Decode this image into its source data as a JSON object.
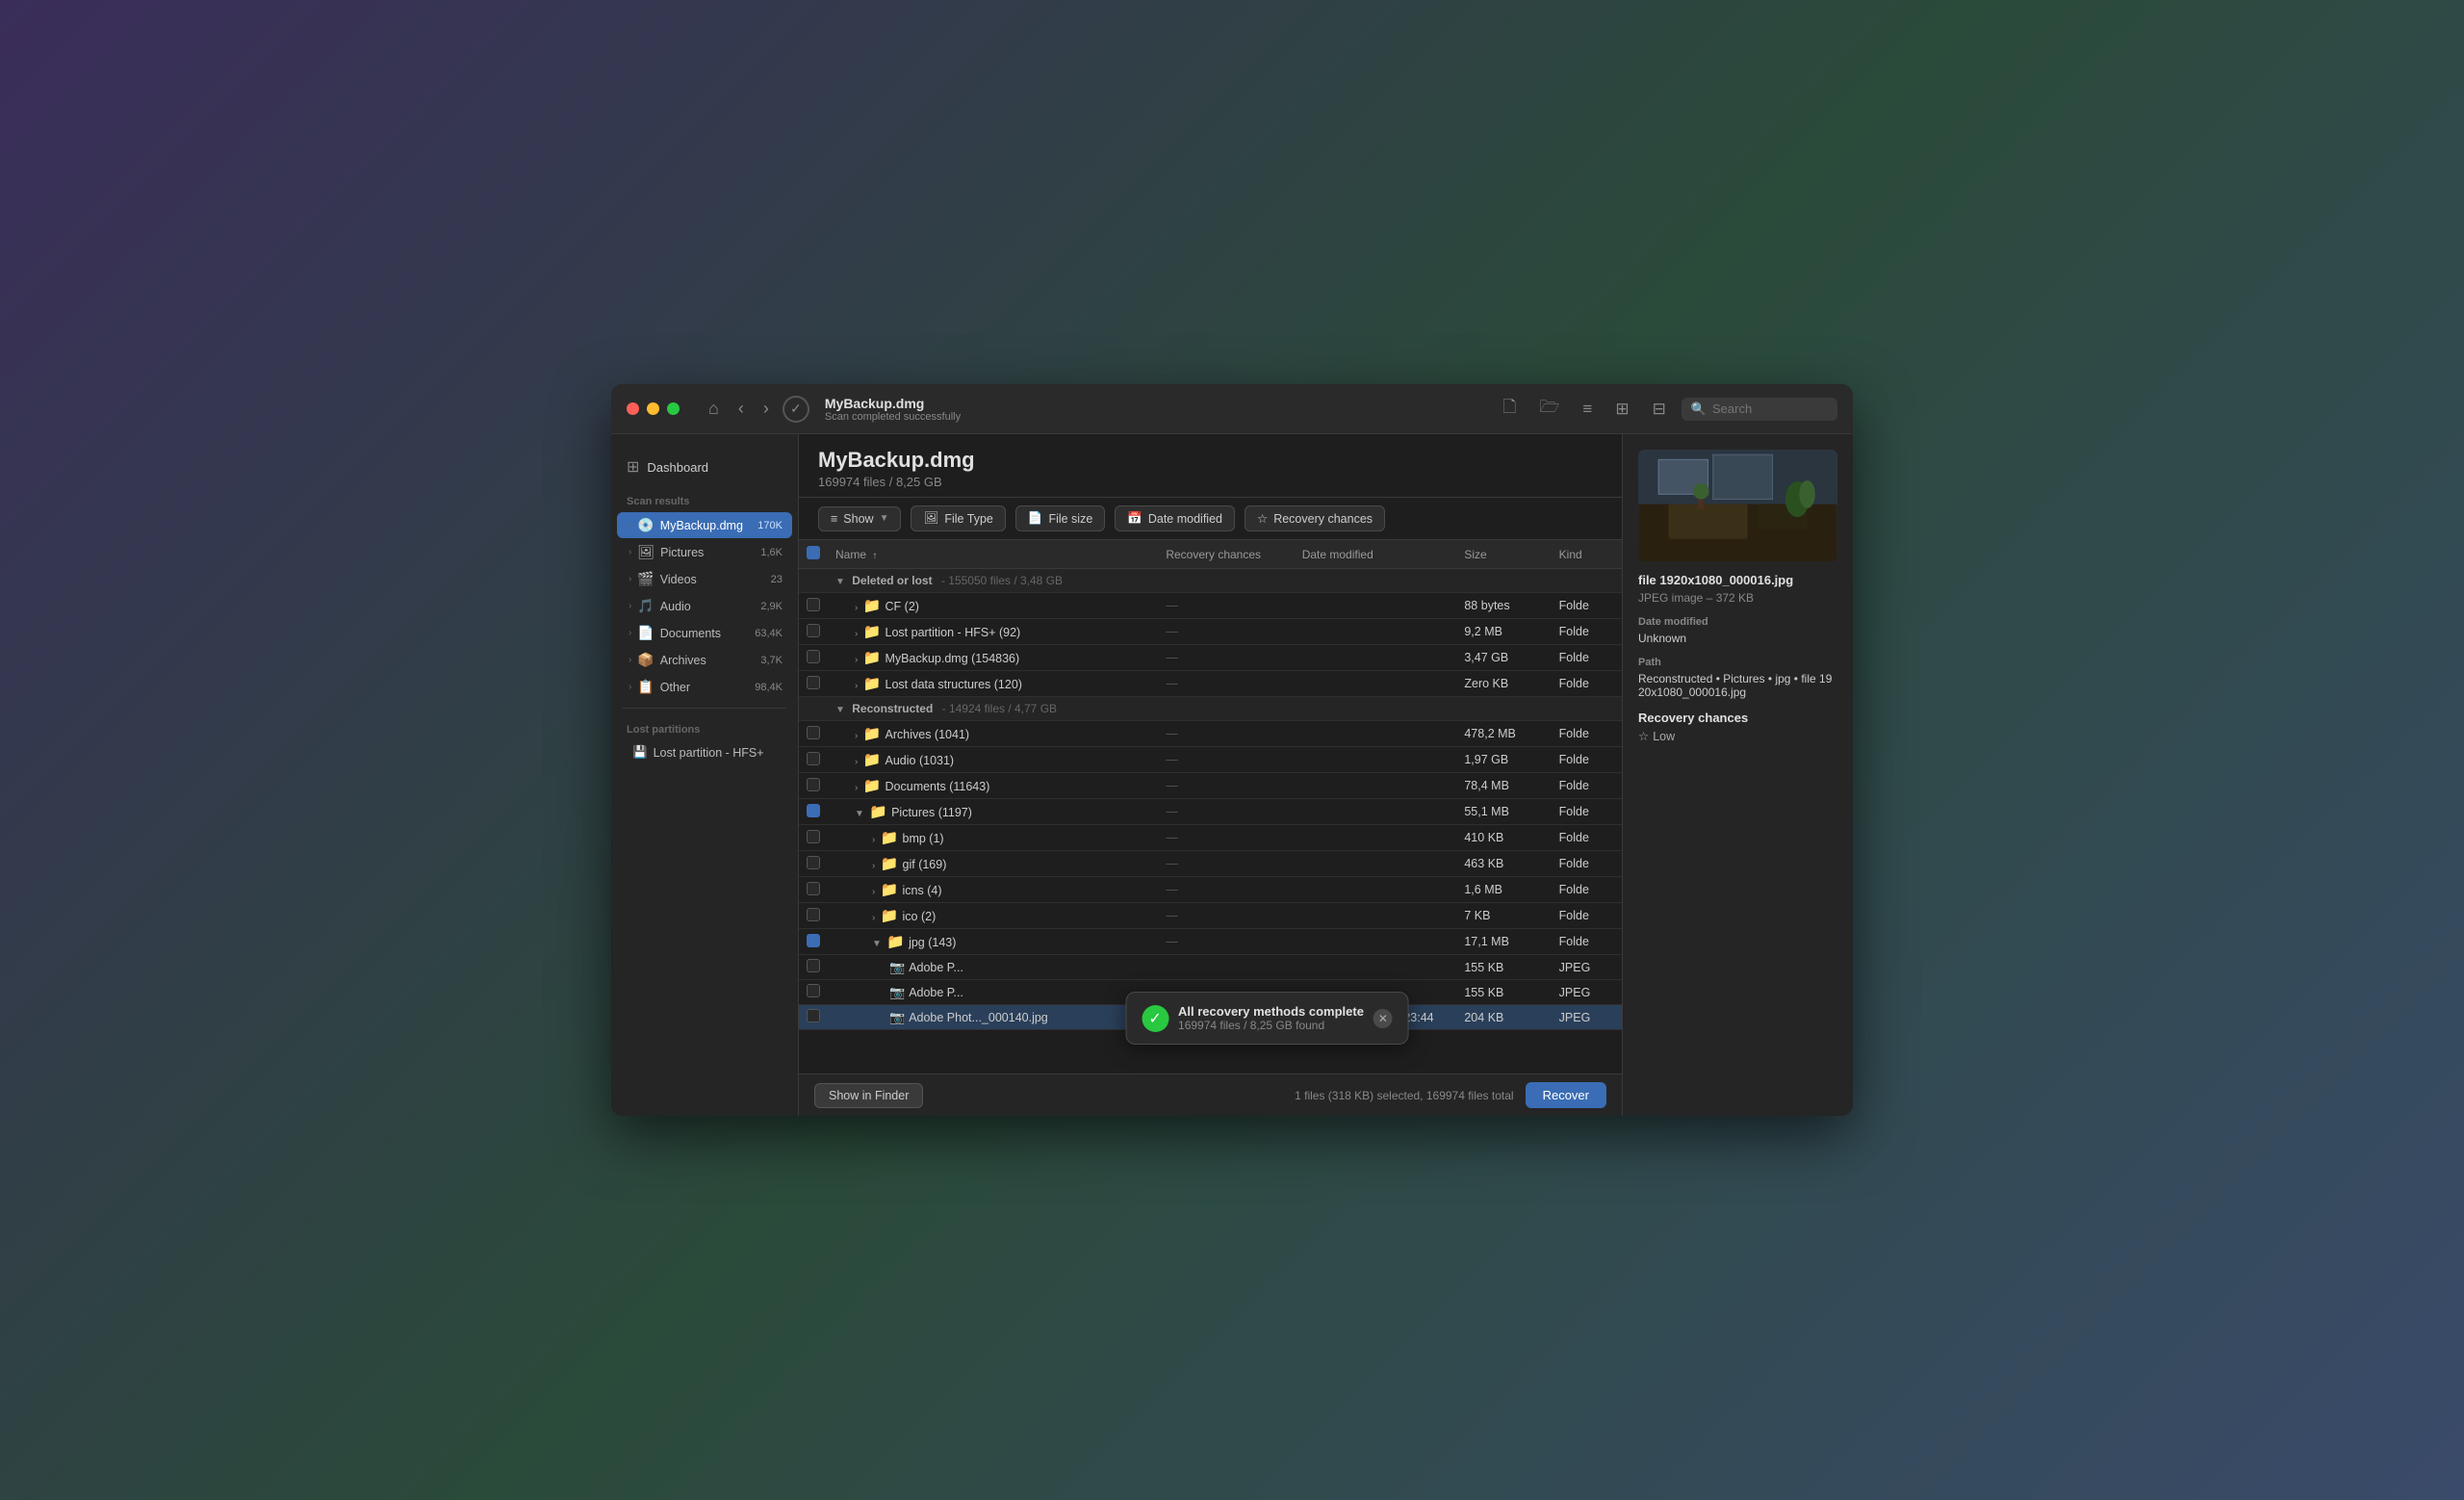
{
  "window": {
    "title": "MyBackup.dmg",
    "subtitle": "Scan completed successfully",
    "traffic_lights": [
      "red",
      "yellow",
      "green"
    ]
  },
  "titlebar": {
    "home_icon": "⌂",
    "back_icon": "‹",
    "forward_icon": "›",
    "check_icon": "✓",
    "file_icon": "🗋",
    "folder_icon": "🗁",
    "list_icon": "☰",
    "grid_icon": "⊞",
    "panel_icon": "⊟",
    "search_placeholder": "Search"
  },
  "main_header": {
    "title": "MyBackup.dmg",
    "stats": "169974 files / 8,25 GB"
  },
  "toolbar": {
    "show_label": "Show",
    "file_type_label": "File Type",
    "file_size_label": "File size",
    "date_modified_label": "Date modified",
    "recovery_chances_label": "Recovery chances"
  },
  "table": {
    "columns": [
      "",
      "Name",
      "Recovery chances",
      "Date modified",
      "Size",
      "Kind"
    ],
    "groups": [
      {
        "label": "Deleted or lost",
        "stats": "155050 files / 3,48 GB",
        "rows": [
          {
            "name": "CF (2)",
            "recovery": "—",
            "date": "",
            "size": "88 bytes",
            "kind": "Folde",
            "indent": 1,
            "type": "folder"
          },
          {
            "name": "Lost partition - HFS+ (92)",
            "recovery": "—",
            "date": "",
            "size": "9,2 MB",
            "kind": "Folde",
            "indent": 1,
            "type": "folder"
          },
          {
            "name": "MyBackup.dmg (154836)",
            "recovery": "—",
            "date": "",
            "size": "3,47 GB",
            "kind": "Folde",
            "indent": 1,
            "type": "folder"
          },
          {
            "name": "Lost data structures (120)",
            "recovery": "—",
            "date": "",
            "size": "Zero KB",
            "kind": "Folde",
            "indent": 1,
            "type": "folder"
          }
        ]
      },
      {
        "label": "Reconstructed",
        "stats": "14924 files / 4,77 GB",
        "rows": [
          {
            "name": "Archives (1041)",
            "recovery": "—",
            "date": "",
            "size": "478,2 MB",
            "kind": "Folde",
            "indent": 1,
            "type": "folder"
          },
          {
            "name": "Audio (1031)",
            "recovery": "—",
            "date": "",
            "size": "1,97 GB",
            "kind": "Folde",
            "indent": 1,
            "type": "folder"
          },
          {
            "name": "Documents (11643)",
            "recovery": "—",
            "date": "",
            "size": "78,4 MB",
            "kind": "Folde",
            "indent": 1,
            "type": "folder"
          },
          {
            "name": "Pictures (1197)",
            "recovery": "—",
            "date": "",
            "size": "55,1 MB",
            "kind": "Folde",
            "indent": 1,
            "type": "folder",
            "partial": true,
            "expanded": true
          },
          {
            "name": "bmp (1)",
            "recovery": "—",
            "date": "",
            "size": "410 KB",
            "kind": "Folde",
            "indent": 2,
            "type": "folder"
          },
          {
            "name": "gif (169)",
            "recovery": "—",
            "date": "",
            "size": "463 KB",
            "kind": "Folde",
            "indent": 2,
            "type": "folder"
          },
          {
            "name": "icns (4)",
            "recovery": "—",
            "date": "",
            "size": "1,6 MB",
            "kind": "Folde",
            "indent": 2,
            "type": "folder"
          },
          {
            "name": "ico (2)",
            "recovery": "—",
            "date": "",
            "size": "7 KB",
            "kind": "Folde",
            "indent": 2,
            "type": "folder"
          },
          {
            "name": "jpg (143)",
            "recovery": "—",
            "date": "",
            "size": "17,1 MB",
            "kind": "Folde",
            "indent": 2,
            "type": "folder",
            "partial": true,
            "expanded": true
          },
          {
            "name": "Adobe P...",
            "recovery": "",
            "date": "",
            "size": "155 KB",
            "kind": "JPEG",
            "indent": 3,
            "type": "file"
          },
          {
            "name": "Adobe P...",
            "recovery": "",
            "date": "",
            "size": "155 KB",
            "kind": "JPEG",
            "indent": 3,
            "type": "file"
          },
          {
            "name": "Adobe Phot..._000140.jpg",
            "recovery": "Low",
            "date": "29 Dec 2022 at 03:23:44",
            "size": "204 KB",
            "kind": "JPEG",
            "indent": 3,
            "type": "file",
            "selected": true
          }
        ]
      }
    ]
  },
  "sidebar": {
    "dashboard_label": "Dashboard",
    "scan_results_label": "Scan results",
    "items": [
      {
        "name": "MyBackup.dmg",
        "badge": "170K",
        "active": true
      },
      {
        "name": "Pictures",
        "badge": "1,6K"
      },
      {
        "name": "Videos",
        "badge": "23"
      },
      {
        "name": "Audio",
        "badge": "2,9K"
      },
      {
        "name": "Documents",
        "badge": "63,4K"
      },
      {
        "name": "Archives",
        "badge": "3,7K"
      },
      {
        "name": "Other",
        "badge": "98,4K"
      }
    ],
    "lost_partitions_label": "Lost partitions",
    "lost_partition_items": [
      {
        "name": "Lost partition - HFS+"
      }
    ]
  },
  "detail_panel": {
    "filename": "file 1920x1080_000016.jpg",
    "filetype": "JPEG image – 372 KB",
    "date_label": "Date modified",
    "date_value": "Unknown",
    "path_label": "Path",
    "path_value": "Reconstructed • Pictures • jpg • file 1920x1080_000016.jpg",
    "recovery_chances_label": "Recovery chances",
    "recovery_value": "Low"
  },
  "notification": {
    "title": "All recovery methods complete",
    "subtitle": "169974 files / 8,25 GB found"
  },
  "bottom_bar": {
    "show_finder_label": "Show in Finder",
    "status_text": "1 files (318 KB) selected, 169974 files total",
    "recover_label": "Recover"
  },
  "colors": {
    "accent": "#3a6db5",
    "bg_dark": "#1e1e1e",
    "bg_sidebar": "#252525",
    "text_primary": "#e0e0e0",
    "text_secondary": "#888888"
  }
}
